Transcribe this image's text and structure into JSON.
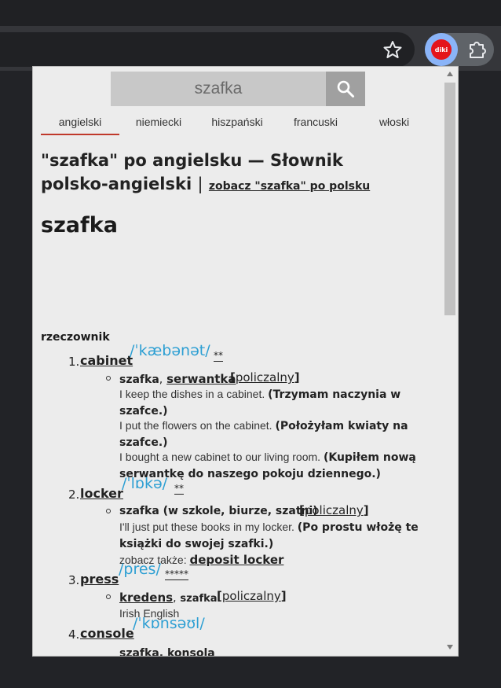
{
  "browser": {
    "star_icon": "star-outline-icon",
    "extension_logo_text": "diki",
    "extensions_icon": "puzzle-icon"
  },
  "search": {
    "value": "szafka",
    "button_icon": "search-icon"
  },
  "lang_tabs": [
    {
      "label": "angielski",
      "active": true
    },
    {
      "label": "niemiecki"
    },
    {
      "label": "hiszpański"
    },
    {
      "label": "francuski"
    },
    {
      "label": "włoski"
    }
  ],
  "title": {
    "main": "\"szafka\" po angielsku — Słownik polsko-angielski",
    "separator": "|",
    "link": "zobacz \"szafka\" po polsku"
  },
  "headword": "szafka",
  "part_of_speech": "rzeczownik",
  "entries": [
    {
      "num": "1.",
      "word": "cabinet",
      "ipa": "/ˈkæbənət/",
      "stars": "**",
      "meaning_lead": "szafka",
      "meaning_comma": ",",
      "meaning_link": "serwantka",
      "tag": "[policzalny]",
      "examples": [
        {
          "en": "I keep the dishes in a cabinet.",
          "pl": "(Trzymam naczynia w szafce.)"
        },
        {
          "en": "I put the flowers on the cabinet.",
          "pl": "(Położyłam kwiaty na szafce.)"
        },
        {
          "en": "I bought a new cabinet to our living room.",
          "pl": "(Kupiłem nową serwantkę do naszego pokoju dziennego.)"
        }
      ]
    },
    {
      "num": "2.",
      "word": "locker",
      "ipa": "/ˈlɒkə/",
      "stars": "**",
      "meaning_lead": "szafka (w szkole, biurze, szatni)",
      "tag": "[policzalny]",
      "examples": [
        {
          "en": "I'll just put these books in my locker.",
          "pl": "(Po prostu włożę te książki do swojej szafki.)"
        }
      ],
      "see_also_label": "zobacz także:",
      "see_also_link": "deposit locker"
    },
    {
      "num": "3.",
      "word": "press",
      "ipa": "/pres/",
      "stars": "*****",
      "meaning_link": "kredens",
      "meaning_comma": ",",
      "meaning_tail": "szafka",
      "tag": "[policzalny]",
      "note": "Irish English"
    },
    {
      "num": "4.",
      "word": "console",
      "ipa": "/ˈkɒnsəʊl/",
      "meaning_partial": "szafka, konsola"
    }
  ]
}
